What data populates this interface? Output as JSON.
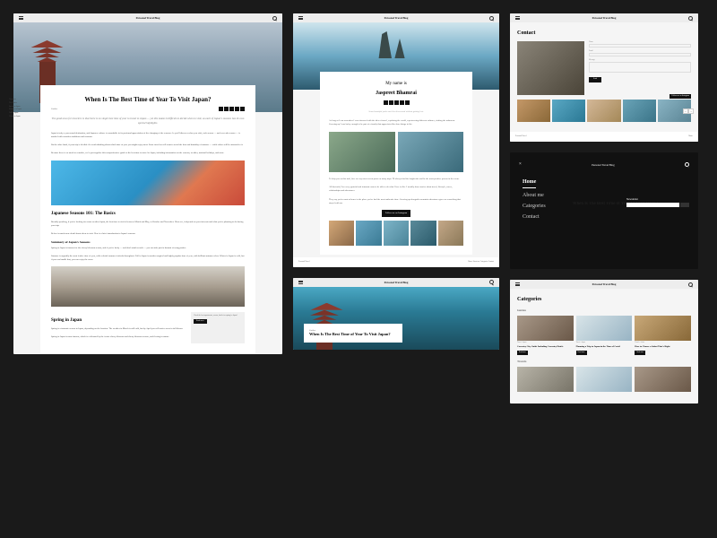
{
  "site_title": "Personal Travel Blog",
  "article": {
    "title": "When Is The Best Time of Year To Visit Japan?",
    "category": "Guides",
    "intro": "The good news for travelers is that there is no single best time of year to travel to Japan — yet this makes it difficult to decide when to visit, as each of Japan's seasons has its own special highlights.",
    "toc": [
      "Overview",
      "The Basics",
      "Spring in Japan",
      "Summer in Japan",
      "Fall in Japan",
      "Winter in Japan"
    ],
    "h2a": "Japanese Seasons 101: The Basics",
    "summary_h": "Summary of Japan's Seasons",
    "h2b": "Spring in Japan",
    "sidebar_tag": "Check the best apartments, rooms, hotels for spring in Japan!",
    "btn": "Read more"
  },
  "about": {
    "intro": "My name is",
    "name": "Jaspreet Bhamrai",
    "quote": "Some beautiful paths can't be discovered without getting lost.",
    "follow": "Follow me on Instagram"
  },
  "footer": {
    "brand": "Personal Travel",
    "links": [
      "Home",
      "About me",
      "Categories",
      "Contact"
    ]
  },
  "contact": {
    "heading": "Contact",
    "name_label": "Name",
    "email_label": "Email",
    "message_label": "Message",
    "submit": "Send",
    "insta_label": "Follow me on Instagram"
  },
  "menu": {
    "items": [
      "Home",
      "About me",
      "Categories",
      "Contact"
    ],
    "newsletter": "Newsletter",
    "bg_title": "When Is The Best Time of Year To Visit Japan?"
  },
  "categories": {
    "heading": "Categories",
    "sub1": "Guides",
    "sub2": "Travels",
    "cards": [
      {
        "meta": "Travel • Japan",
        "title": "Coventry City Guide Including Coventry Hotels",
        "btn": "Read more"
      },
      {
        "meta": "Travel • Japan",
        "title": "Planning a Trip to Japan in the Time of Covid",
        "btn": "Read more"
      },
      {
        "meta": "Travel • Africa",
        "title": "How to Choose a Safari That's Right",
        "btn": "Read more"
      }
    ]
  }
}
